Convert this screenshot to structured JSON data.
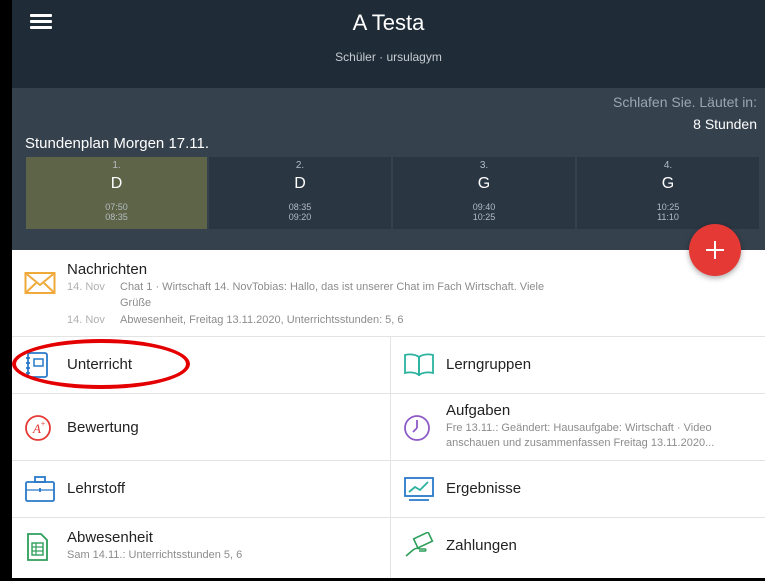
{
  "app": {
    "title": "A Testa",
    "subtitle": "Schüler · ursulagym"
  },
  "status": {
    "line1": "Schlafen Sie. Läutet in:",
    "line2": "8 Stunden"
  },
  "timetable": {
    "title": "Stundenplan Morgen 17.11.",
    "periods": [
      {
        "num": "1.",
        "subject": "D",
        "start": "07:50",
        "end": "08:35",
        "active": true
      },
      {
        "num": "2.",
        "subject": "D",
        "start": "08:35",
        "end": "09:20",
        "active": false
      },
      {
        "num": "3.",
        "subject": "G",
        "start": "09:40",
        "end": "10:25",
        "active": false
      },
      {
        "num": "4.",
        "subject": "G",
        "start": "10:25",
        "end": "11:10",
        "active": false
      }
    ]
  },
  "nachrichten": {
    "title": "Nachrichten",
    "items": [
      {
        "date": "14. Nov",
        "text": "Chat 1 · Wirtschaft 14. NovTobias: Hallo, das ist unserer Chat im Fach Wirtschaft. Viele",
        "text2": "Grüße"
      },
      {
        "date": "14. Nov",
        "text": "Abwesenheit, Freitag 13.11.2020, Unterrichtsstunden: 5, 6"
      }
    ]
  },
  "tiles": {
    "unterricht": {
      "label": "Unterricht"
    },
    "lerngruppen": {
      "label": "Lerngruppen"
    },
    "bewertung": {
      "label": "Bewertung"
    },
    "aufgaben": {
      "label": "Aufgaben",
      "sub1": "Fre 13.11.: Geändert: Hausaufgabe: Wirtschaft · Video",
      "sub2": "anschauen und zusammenfassen Freitag 13.11.2020..."
    },
    "lehrstoff": {
      "label": "Lehrstoff"
    },
    "ergebnisse": {
      "label": "Ergebnisse"
    },
    "abwesenheit": {
      "label": "Abwesenheit",
      "sub": "Sam 14.11.: Unterrichtsstunden 5, 6"
    },
    "zahlungen": {
      "label": "Zahlungen"
    }
  },
  "colors": {
    "appbar": "#1f2b37",
    "timetable_bg": "#35414d",
    "active_period": "#5d6448",
    "fab": "#e53935",
    "icon_orange": "#f0a93b",
    "icon_teal": "#2bb3a0",
    "icon_blue": "#2979c9",
    "icon_purple": "#8e5bc7",
    "icon_red": "#e53935",
    "icon_green": "#2e9e5a",
    "highlight": "#e40000"
  }
}
